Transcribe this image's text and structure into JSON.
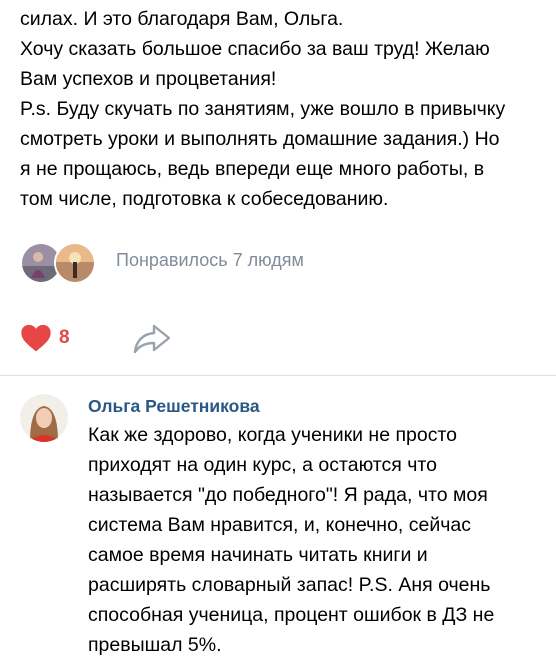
{
  "post": {
    "text_lines": [
      "силах. И это благодаря Вам, Ольга.",
      "Хочу сказать большое спасибо за ваш труд! Желаю",
      "Вам успехов и процветания!",
      "P.s. Буду скучать по занятиям, уже вошло в привычку",
      "смотреть уроки и выполнять домашние задания.) Но",
      "я не прощаюсь, ведь впереди еще много работы, в",
      "том числе, подготовка к собеседованию."
    ],
    "liked_text": "Понравилось 7 людям",
    "like_count": "8",
    "like_color": "#e64646"
  },
  "comment": {
    "author": "Ольга Решетникова",
    "author_color": "#2a5885",
    "text_lines": [
      "Как же здорово, когда ученики не просто",
      "приходят на один курс, а остаются что",
      "называется \"до победного\"! Я рада, что моя",
      "система Вам нравится, и, конечно, сейчас",
      "самое время начинать читать книги и",
      "расширять словарный запас! P.S. Аня очень",
      "способная ученица, процент ошибок в ДЗ не",
      "превышал 5%."
    ]
  },
  "icons": {
    "like": "heart-icon",
    "share": "share-arrow-icon"
  }
}
